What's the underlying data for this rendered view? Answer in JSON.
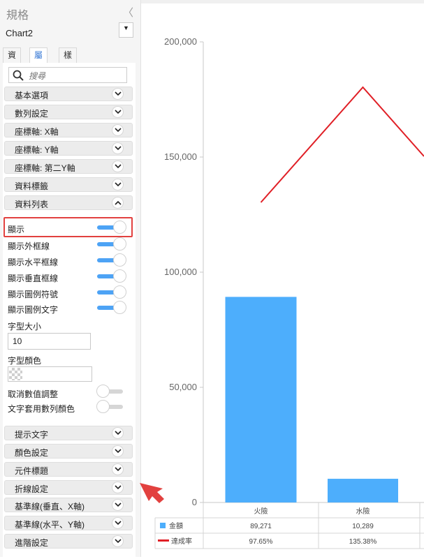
{
  "panel": {
    "title": "規格",
    "collapse_glyph": "〈",
    "chart_name": "Chart2",
    "dropdown_glyph": "▼",
    "tabs": [
      "資料",
      "屬性",
      "樣式"
    ],
    "active_tab": "屬性",
    "search_placeholder": "搜尋"
  },
  "sections_top": [
    {
      "label": "基本選項",
      "expanded": false
    },
    {
      "label": "數列設定",
      "expanded": false
    },
    {
      "label": "座標軸: X軸",
      "expanded": false
    },
    {
      "label": "座標軸: Y軸",
      "expanded": false
    },
    {
      "label": "座標軸: 第二Y軸",
      "expanded": false
    },
    {
      "label": "資料標籤",
      "expanded": false
    },
    {
      "label": "資料列表",
      "expanded": true
    }
  ],
  "data_table_settings": {
    "toggles_on": [
      {
        "label": "顯示",
        "on": true
      },
      {
        "label": "顯示外框線",
        "on": true
      },
      {
        "label": "顯示水平框線",
        "on": true
      },
      {
        "label": "顯示垂直框線",
        "on": true
      },
      {
        "label": "顯示圖例符號",
        "on": true
      },
      {
        "label": "顯示圖例文字",
        "on": true
      }
    ],
    "font_size_label": "字型大小",
    "font_size_value": "10",
    "font_color_label": "字型顏色",
    "toggles_off": [
      {
        "label": "取消數值調整",
        "on": false
      },
      {
        "label": "文字套用數列顏色",
        "on": false
      }
    ]
  },
  "sections_bottom": [
    {
      "label": "提示文字",
      "expanded": false
    },
    {
      "label": "顏色設定",
      "expanded": false
    },
    {
      "label": "元件標題",
      "expanded": false
    },
    {
      "label": "折線設定",
      "expanded": false
    },
    {
      "label": "基準線(垂直、X軸)",
      "expanded": false
    },
    {
      "label": "基準線(水平、Y軸)",
      "expanded": false
    },
    {
      "label": "進階設定",
      "expanded": false
    }
  ],
  "colors": {
    "bar": "#4daefc",
    "line": "#e01f26",
    "highlight": "#e2413f",
    "toggle_on": "#4da3f5"
  },
  "chart_data": {
    "type": "bar",
    "categories": [
      "火險",
      "水險"
    ],
    "series": [
      {
        "name": "金額",
        "type": "bar",
        "values": [
          89271,
          10289
        ],
        "table_values": [
          "89,271",
          "10,289"
        ],
        "color": "#4daefc"
      },
      {
        "name": "達成率",
        "type": "line",
        "y_axis": "secondary",
        "values": [
          97.65,
          135.38
        ],
        "table_values": [
          "97.65%",
          "135.38%"
        ],
        "color": "#e01f26",
        "continues_to_next_category": true
      }
    ],
    "y_ticks": [
      "200,000",
      "150,000",
      "100,000",
      "50,000",
      "0"
    ],
    "y_tick_values": [
      200000,
      150000,
      100000,
      50000,
      0
    ],
    "ylim": [
      0,
      200000
    ],
    "grid": false,
    "data_table": true
  }
}
